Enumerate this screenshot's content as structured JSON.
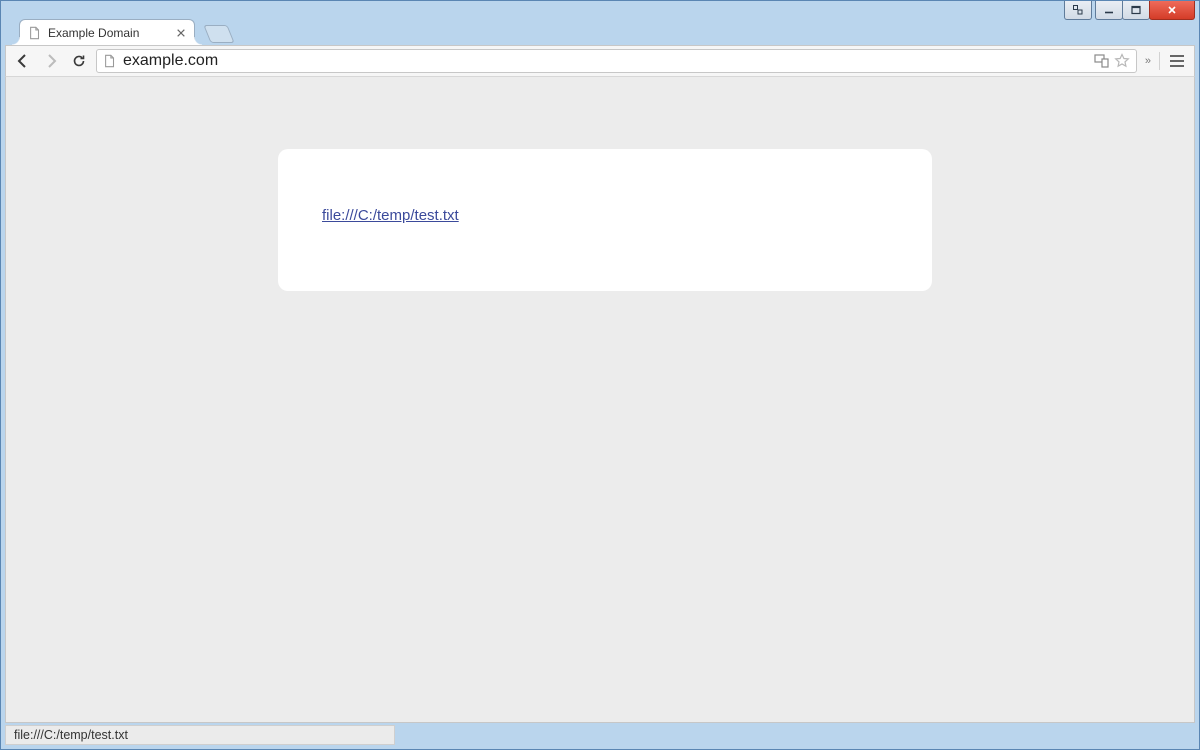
{
  "tab": {
    "title": "Example Domain"
  },
  "omnibox": {
    "url": "example.com"
  },
  "page": {
    "link_text": "file:///C:/temp/test.txt"
  },
  "status_bar": {
    "text": "file:///C:/temp/test.txt"
  }
}
